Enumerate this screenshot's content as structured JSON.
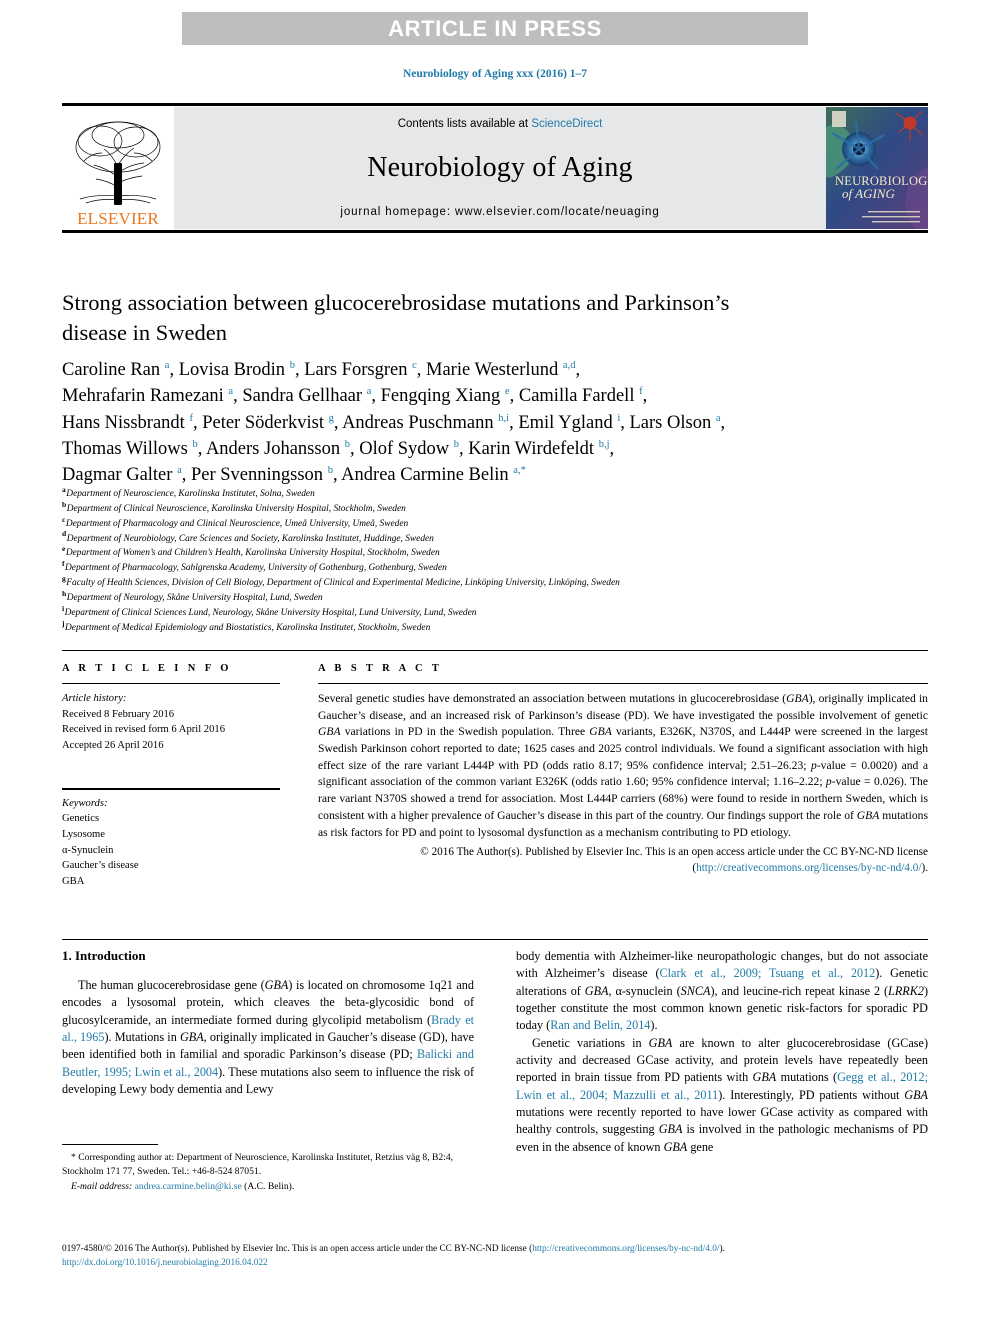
{
  "banner": {
    "text": "ARTICLE IN PRESS"
  },
  "citation": {
    "text": "Neurobiology of Aging xxx (2016) 1–7",
    "color": "#1f7ba8"
  },
  "masthead": {
    "contents_prefix": "Contents lists available at ",
    "contents_link": "ScienceDirect",
    "journal_title": "Neurobiology of Aging",
    "homepage": "journal homepage: www.elsevier.com/locate/neuaging",
    "publisher_logo_label": "ELSEVIER",
    "publisher_logo_color": "#e87722",
    "cover_title_line1": "NEUROBIOLOGY",
    "cover_title_line2": "of AGING"
  },
  "article": {
    "title": "Strong association between glucocerebrosidase mutations and Parkinson’s disease in Sweden",
    "authors_html": "Caroline Ran <sup>a</sup>, Lovisa Brodin <sup>b</sup>, Lars Forsgren <sup>c</sup>, Marie Westerlund <sup>a,d</sup>,<br>Mehrafarin Ramezani <sup>a</sup>, Sandra Gellhaar <sup>a</sup>, Fengqing Xiang <sup>e</sup>, Camilla Fardell <sup>f</sup>,<br>Hans Nissbrandt <sup>f</sup>, Peter Söderkvist <sup>g</sup>, Andreas Puschmann <sup>h,i</sup>, Emil Ygland <sup>i</sup>, Lars Olson <sup>a</sup>,<br>Thomas Willows <sup>b</sup>, Anders Johansson <sup>b</sup>, Olof Sydow <sup>b</sup>, Karin Wirdefeldt <sup>b,j</sup>,<br>Dagmar Galter <sup>a</sup>, Per Svenningsson <sup>b</sup>, Andrea Carmine Belin <sup>a,*</sup>",
    "affiliations": [
      {
        "marker": "a",
        "text": "Department of Neuroscience, Karolinska Institutet, Solna, Sweden"
      },
      {
        "marker": "b",
        "text": "Department of Clinical Neuroscience, Karolinska University Hospital, Stockholm, Sweden"
      },
      {
        "marker": "c",
        "text": "Department of Pharmacology and Clinical Neuroscience, Umeå University, Umeå, Sweden"
      },
      {
        "marker": "d",
        "text": "Department of Neurobiology, Care Sciences and Society, Karolinska Institutet, Huddinge, Sweden"
      },
      {
        "marker": "e",
        "text": "Department of Women’s and Children’s Health, Karolinska University Hospital, Stockholm, Sweden"
      },
      {
        "marker": "f",
        "text": "Department of Pharmacology, Sahlgrenska Academy, University of Gothenburg, Gothenburg, Sweden"
      },
      {
        "marker": "g",
        "text": "Faculty of Health Sciences, Division of Cell Biology, Department of Clinical and Experimental Medicine, Linköping University, Linköping, Sweden"
      },
      {
        "marker": "h",
        "text": "Department of Neurology, Skåne University Hospital, Lund, Sweden"
      },
      {
        "marker": "i",
        "text": "Department of Clinical Sciences Lund, Neurology, Skåne University Hospital, Lund University, Lund, Sweden"
      },
      {
        "marker": "j",
        "text": "Department of Medical Epidemiology and Biostatistics, Karolinska Institutet, Stockholm, Sweden"
      }
    ]
  },
  "article_info": {
    "heading": "A R T I C L E  I N F O",
    "history_label": "Article history:",
    "history": [
      "Received 8 February 2016",
      "Received in revised form 6 April 2016",
      "Accepted 26 April 2016"
    ],
    "keywords_label": "Keywords:",
    "keywords": [
      "Genetics",
      "Lysosome",
      "α-Synuclein",
      "Gaucher’s disease",
      "GBA"
    ]
  },
  "abstract": {
    "heading": "A B S T R A C T",
    "body_html": "Several genetic studies have demonstrated an association between mutations in glucocerebrosidase (<i>GBA</i>), originally implicated in Gaucher’s disease, and an increased risk of Parkinson’s disease (PD). We have investigated the possible involvement of genetic <i>GBA</i> variations in PD in the Swedish population. Three <i>GBA</i> variants, E326K, N370S, and L444P were screened in the largest Swedish Parkinson cohort reported to date; 1625 cases and 2025 control individuals. We found a significant association with high effect size of the rare variant L444P with PD (odds ratio 8.17; 95% confidence interval; 2.51–26.23; <i>p</i>-value = 0.0020) and a significant association of the common variant E326K (odds ratio 1.60; 95% confidence interval; 1.16–2.22; <i>p</i>-value = 0.026). The rare variant N370S showed a trend for association. Most L444P carriers (68%) were found to reside in northern Sweden, which is consistent with a higher prevalence of Gaucher’s disease in this part of the country. Our findings support the role of <i>GBA</i> mutations as risk factors for PD and point to lysosomal dysfunction as a mechanism contributing to PD etiology.",
    "copyright_prefix": "© 2016 The Author(s). Published by Elsevier Inc. This is an open access article under the CC BY-NC-ND license (",
    "copyright_link": "http://creativecommons.org/licenses/by-nc-nd/4.0/",
    "copyright_suffix": ")."
  },
  "introduction": {
    "heading": "1. Introduction",
    "left_para_html": "The human glucocerebrosidase gene (<i>GBA</i>) is located on chromosome 1q21 and encodes a lysosomal protein, which cleaves the beta-glycosidic bond of glucosylceramide, an intermediate formed during glycolipid metabolism (<span class=\"ref\">Brady et al., 1965</span>). Mutations in <i>GBA</i>, originally implicated in Gaucher’s disease (GD), have been identified both in familial and sporadic Parkinson’s disease (PD; <span class=\"ref\">Balicki and Beutler, 1995; Lwin et al., 2004</span>). These mutations also seem to influence the risk of developing Lewy body dementia and Lewy",
    "right_para1_html": "body dementia with Alzheimer-like neuropathologic changes, but do not associate with Alzheimer’s disease (<span class=\"ref\">Clark et al., 2009; Tsuang et al., 2012</span>). Genetic alterations of <i>GBA</i>, α-synuclein (<i>SNCA</i>), and leucine-rich repeat kinase 2 (<i>LRRK2</i>) together constitute the most common known genetic risk-factors for sporadic PD today (<span class=\"ref\">Ran and Belin, 2014</span>).",
    "right_para2_html": "Genetic variations in <i>GBA</i> are known to alter glucocerebrosidase (GCase) activity and decreased GCase activity, and protein levels have repeatedly been reported in brain tissue from PD patients with <i>GBA</i> mutations (<span class=\"ref\">Gegg et al., 2012; Lwin et al., 2004; Mazzulli et al., 2011</span>). Interestingly, PD patients without <i>GBA</i> mutations were recently reported to have lower GCase activity as compared with healthy controls, suggesting <i>GBA</i> is involved in the pathologic mechanisms of PD even in the absence of known <i>GBA</i> gene"
  },
  "footnote": {
    "corresponding_html": "* Corresponding author at: Department of Neuroscience, Karolinska Institutet, Retzius väg 8, B2:4, Stockholm 171 77, Sweden. Tel.: +46-8-524 87051.",
    "email_label": "E-mail address:",
    "email": "andrea.carmine.belin@ki.se",
    "email_owner": "(A.C. Belin)."
  },
  "legal": {
    "issn_line_prefix": "0197-4580/© 2016 The Author(s). Published by Elsevier Inc. This is an open access article under the CC BY-NC-ND license (",
    "issn_line_link": "http://creativecommons.org/licenses/by-nc-nd/4.0/",
    "issn_line_suffix": ").",
    "doi": "http://dx.doi.org/10.1016/j.neurobiolaging.2016.04.022"
  }
}
